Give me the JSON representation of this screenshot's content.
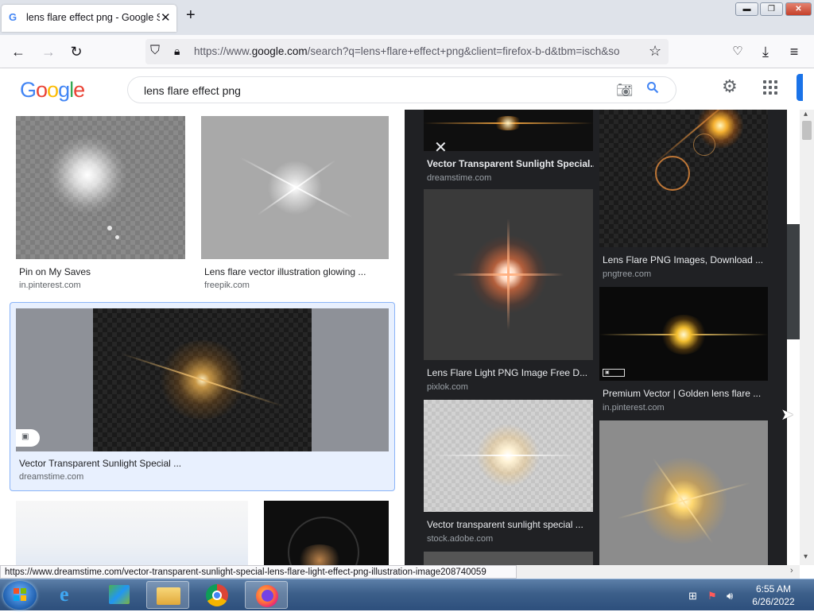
{
  "browser": {
    "tab_title": "lens flare effect png - Google Se",
    "url_prefix": "https://www.",
    "url_domain": "google.com",
    "url_rest": "/search?q=lens+flare+effect+png&client=firefox-b-d&tbm=isch&so"
  },
  "search": {
    "query": "lens flare effect png"
  },
  "results_left": [
    {
      "title": "Pin on My Saves",
      "source": "in.pinterest.com"
    },
    {
      "title": "Lens flare vector illustration glowing ...",
      "source": "freepik.com"
    },
    {
      "title": "Vector Transparent Sunlight Special ...",
      "source": "dreamstime.com"
    }
  ],
  "panel": {
    "col1": [
      {
        "title": "Vector Transparent Sunlight Special...",
        "source": "dreamstime.com"
      },
      {
        "title": "Lens Flare Light PNG Image Free D...",
        "source": "pixlok.com"
      },
      {
        "title": "Vector transparent sunlight special ...",
        "source": "stock.adobe.com"
      }
    ],
    "col2": [
      {
        "title": "Lens Flare PNG Images, Download ...",
        "source": "pngtree.com"
      },
      {
        "title": "Premium Vector | Golden lens flare ...",
        "source": "in.pinterest.com"
      }
    ]
  },
  "status_url": "https://www.dreamstime.com/vector-transparent-sunlight-special-lens-flare-light-effect-png-illustration-image208740059",
  "clock": {
    "time": "6:55 AM",
    "date": "6/26/2022"
  },
  "colors": {
    "accent": "#4285f4",
    "panel_bg": "#202124",
    "selected_border": "#8ab4f8"
  }
}
